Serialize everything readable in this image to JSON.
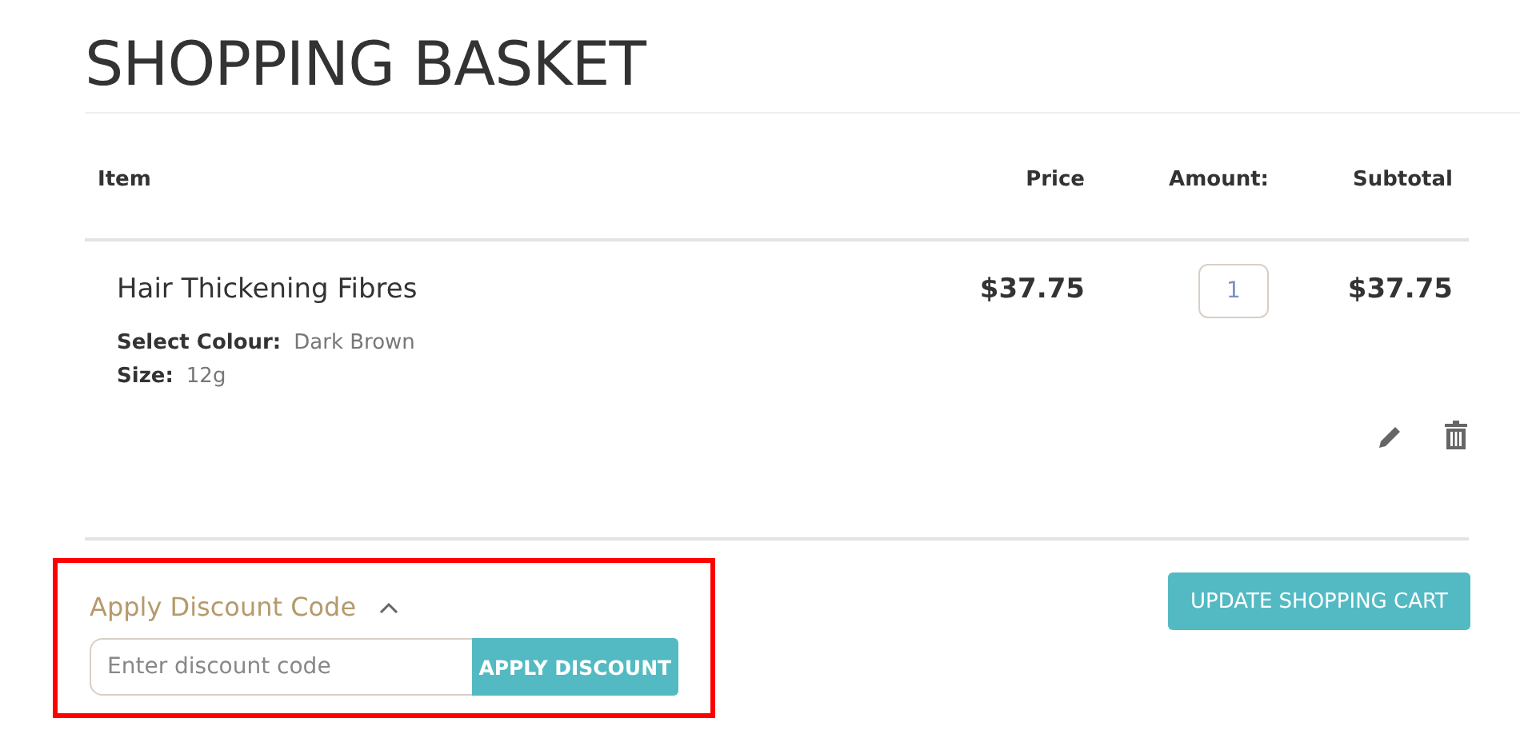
{
  "title": "SHOPPING BASKET",
  "table": {
    "columns": [
      "Item",
      "Price",
      "Amount:",
      "Subtotal"
    ],
    "rows": [
      {
        "name": "Hair Thickening Fibres",
        "options": [
          {
            "label": "Select Colour:",
            "value": "Dark Brown"
          },
          {
            "label": "Size:",
            "value": "12g"
          }
        ],
        "price": "$37.75",
        "amount": "1",
        "subtotal": "$37.75"
      }
    ]
  },
  "discount": {
    "title": "Apply Discount Code",
    "expanded": true,
    "highlighted": true,
    "placeholder": "Enter discount code",
    "button": "APPLY DISCOUNT"
  },
  "update_button": "UPDATE SHOPPING CART"
}
